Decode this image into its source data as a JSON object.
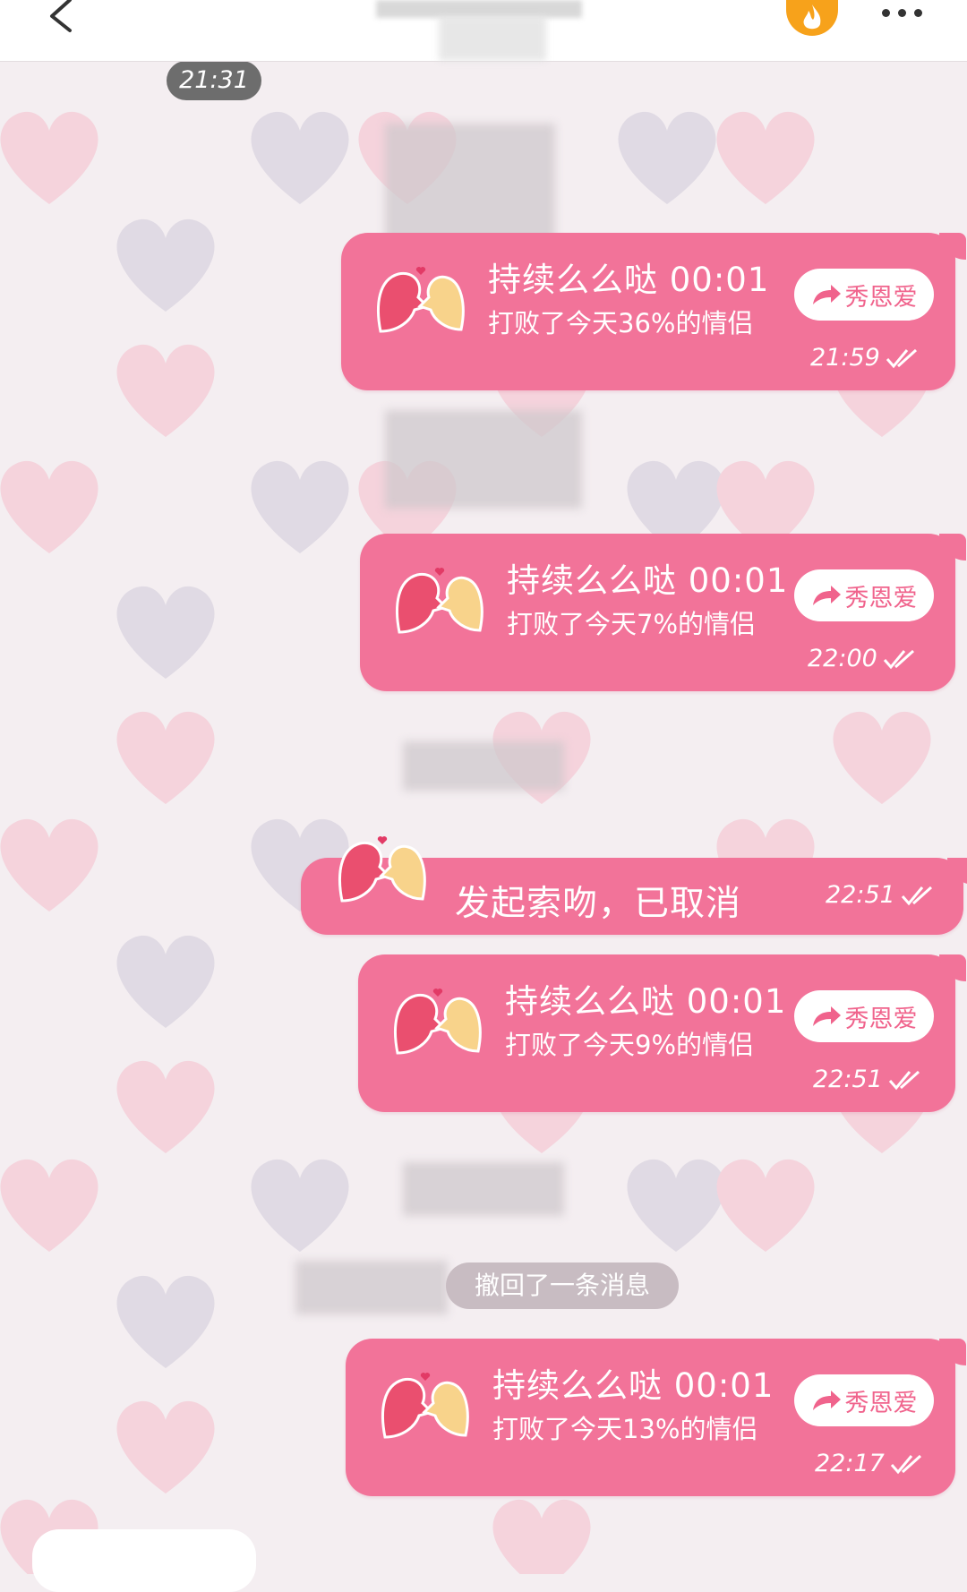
{
  "header": {
    "back_icon": "chevron-left-icon",
    "fire_icon": "flame-icon",
    "more_icon": "ellipsis-icon"
  },
  "chat": {
    "first_time": "21:31",
    "recall_text": "撤回了一条消息",
    "messages": [
      {
        "title": "持续么么哒 00:01",
        "subtitle": "打败了今天36%的情侣",
        "button": "秀恩爱",
        "time": "21:59"
      },
      {
        "title": "持续么么哒 00:01",
        "subtitle": "打败了今天7%的情侣",
        "button": "秀恩爱",
        "time": "22:00"
      },
      {
        "title": "发起索吻，已取消",
        "time": "22:51"
      },
      {
        "title": "持续么么哒 00:01",
        "subtitle": "打败了今天9%的情侣",
        "button": "秀恩爱",
        "time": "22:51"
      },
      {
        "title": "持续么么哒 00:01",
        "subtitle": "打败了今天13%的情侣",
        "button": "秀恩爱",
        "time": "22:17"
      }
    ]
  },
  "colors": {
    "bubble": "#f27399",
    "background": "#f4eef1",
    "button_text": "#f0638c",
    "fire": "#f7a21b"
  }
}
